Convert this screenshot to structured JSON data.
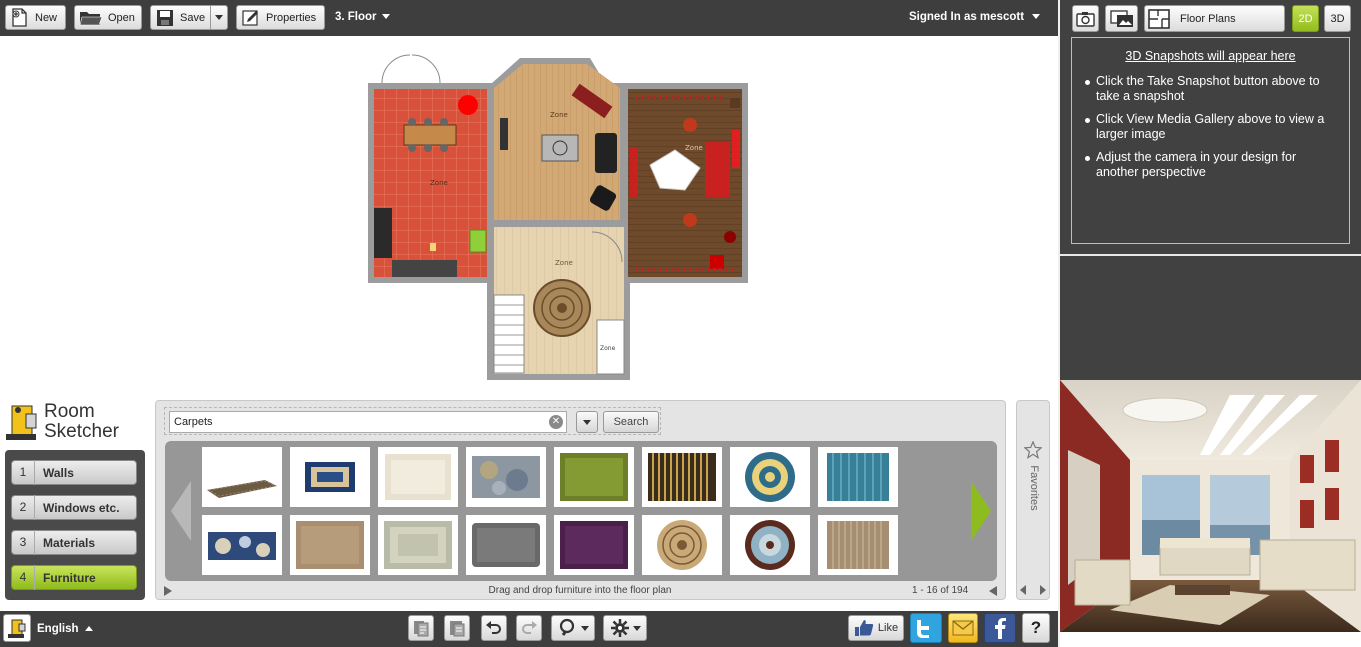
{
  "toolbar": {
    "new_label": "New",
    "open_label": "Open",
    "save_label": "Save",
    "properties_label": "Properties",
    "floor_label": "3. Floor",
    "signed_in_label": "Signed In as mescott"
  },
  "right_panel": {
    "floor_plans_label": "Floor Plans",
    "view_2d": "2D",
    "view_3d": "3D",
    "snapshot_title": "3D Snapshots will appear here",
    "tips": [
      "Click the Take Snapshot button above to take a snapshot",
      "Click View Media Gallery above to view a larger image",
      "Adjust the camera in your design for another perspective"
    ]
  },
  "floorplan": {
    "zone_labels": [
      "Zone",
      "Zone",
      "Zone",
      "Zone",
      "Zone"
    ]
  },
  "logo": {
    "line1": "Room",
    "line2": "Sketcher"
  },
  "steps": [
    {
      "num": "1",
      "label": "Walls",
      "active": false
    },
    {
      "num": "2",
      "label": "Windows etc.",
      "active": false
    },
    {
      "num": "3",
      "label": "Materials",
      "active": false
    },
    {
      "num": "4",
      "label": "Furniture",
      "active": true
    }
  ],
  "catalog": {
    "search_value": "Carpets",
    "search_button": "Search",
    "hint": "Drag and drop furniture into the floor plan",
    "paging": "1 - 16 of 194",
    "favorites_label": "Favorites"
  },
  "bottom": {
    "language": "English",
    "like_label": "Like"
  },
  "colors": {
    "toolbar_bg": "#3e3e3e",
    "accent_green": "#a3cc2b",
    "kitchen_tile": "#d9513a"
  }
}
